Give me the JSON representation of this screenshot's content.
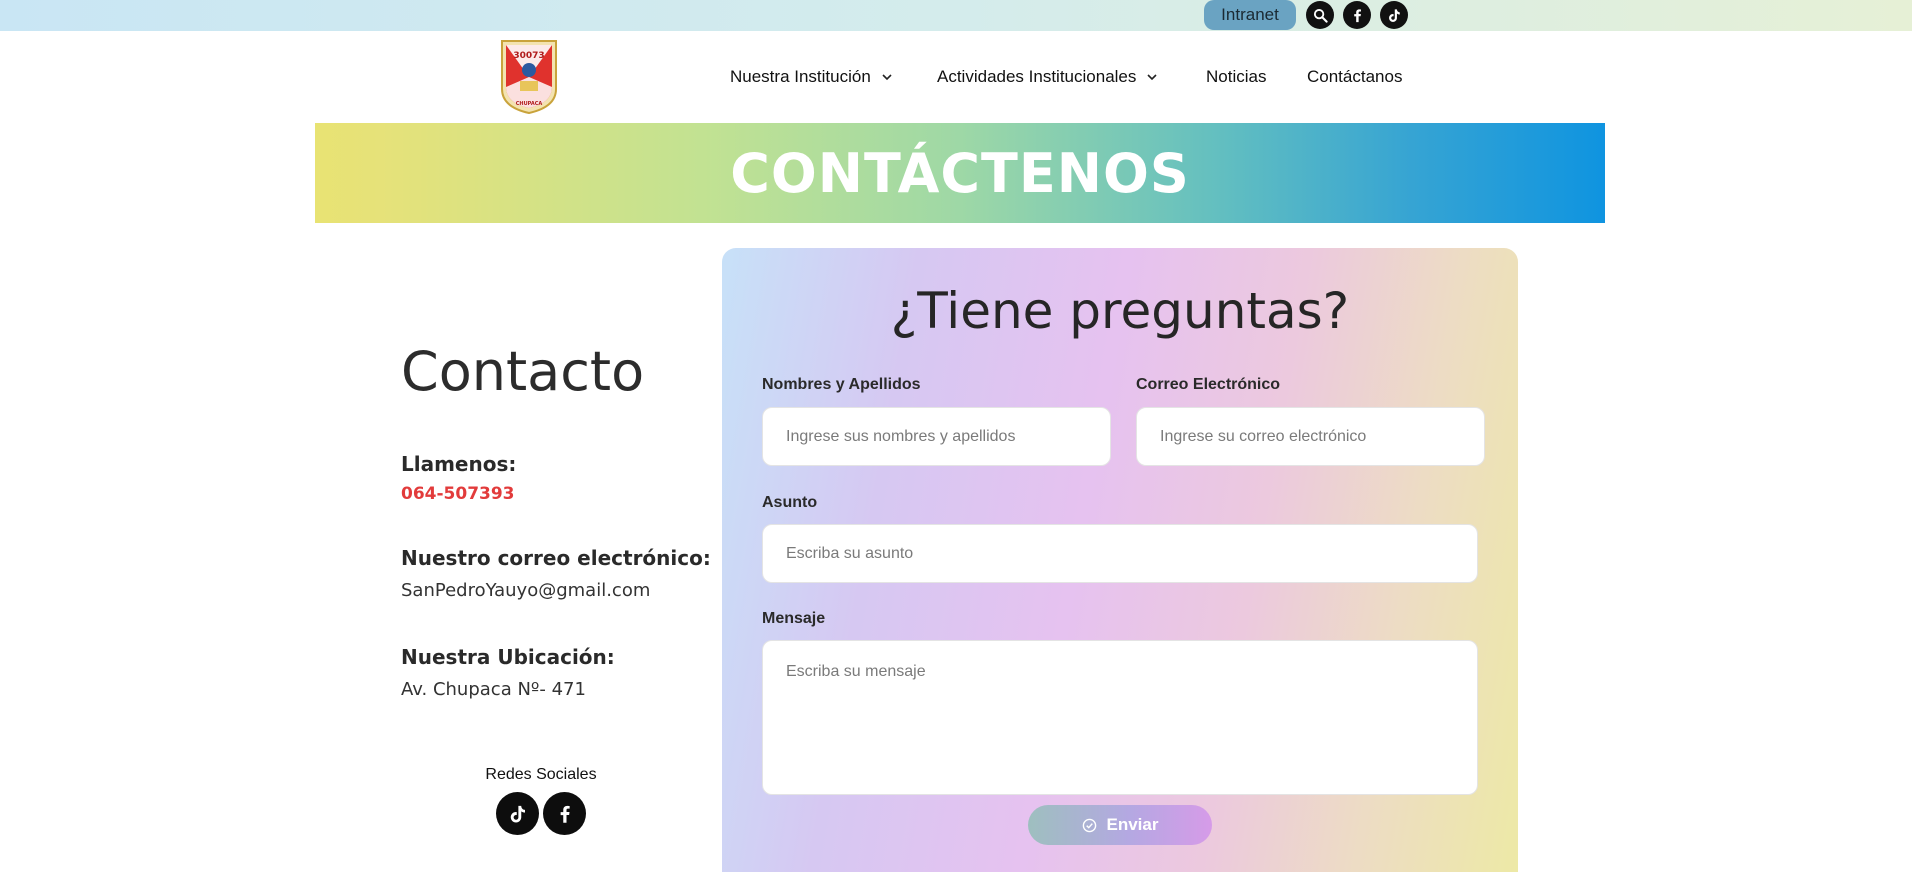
{
  "topbar": {
    "intranet_label": "Intranet",
    "icons": [
      "search-icon",
      "facebook-icon",
      "tiktok-icon"
    ]
  },
  "header": {
    "logo": {
      "text_top": "30073",
      "text_bottom": "CHUPACA"
    },
    "nav": [
      {
        "label": "Nuestra Institución",
        "dropdown": true
      },
      {
        "label": "Actividades Institucionales",
        "dropdown": true
      },
      {
        "label": "Noticias",
        "dropdown": false
      },
      {
        "label": "Contáctanos",
        "dropdown": false
      }
    ]
  },
  "banner": {
    "title": "CONTÁCTENOS"
  },
  "contact": {
    "title": "Contacto",
    "phone_label": "Llamenos:",
    "phone": "064-507393",
    "email_label": "Nuestro correo electrónico:",
    "email": "SanPedroYauyo@gmail.com",
    "location_label": "Nuestra Ubicación:",
    "location": "Av. Chupaca Nº- 471",
    "social_title": "Redes Sociales",
    "social_icons": [
      "tiktok-icon",
      "facebook-icon"
    ]
  },
  "form": {
    "title": "¿Tiene preguntas?",
    "name_label": "Nombres y Apellidos",
    "name_placeholder": "Ingrese sus nombres y apellidos",
    "email_label": "Correo Electrónico",
    "email_placeholder": "Ingrese su correo electrónico",
    "subject_label": "Asunto",
    "subject_placeholder": "Escriba su asunto",
    "message_label": "Mensaje",
    "message_placeholder": "Escriba su mensaje",
    "submit_label": "Enviar"
  },
  "colors": {
    "phone": "#e23b3b",
    "intranet_bg": "#6aa3c2",
    "banner_start": "#e8e373",
    "banner_end": "#0f94e0"
  }
}
